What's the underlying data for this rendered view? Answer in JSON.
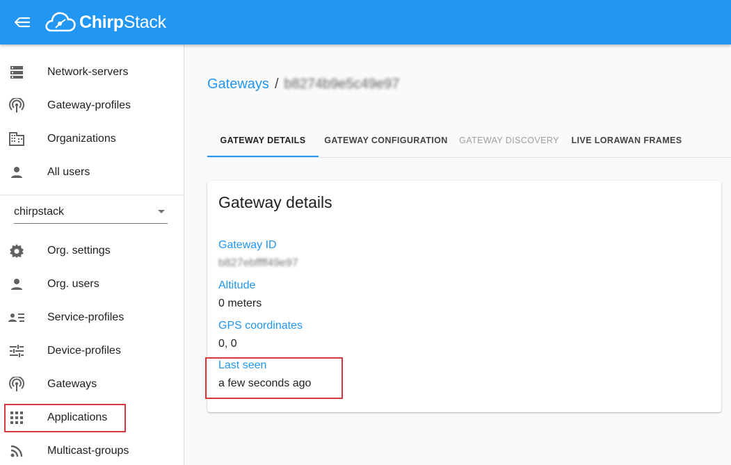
{
  "app": {
    "logo_text_bold": "Chirp",
    "logo_text_rest": "Stack"
  },
  "sidebar": {
    "admin_items": [
      {
        "label": "Network-servers",
        "icon": "server-icon"
      },
      {
        "label": "Gateway-profiles",
        "icon": "antenna-icon"
      },
      {
        "label": "Organizations",
        "icon": "domain-icon"
      },
      {
        "label": "All users",
        "icon": "person-icon"
      }
    ],
    "org_select": {
      "value": "chirpstack"
    },
    "org_items": [
      {
        "label": "Org. settings",
        "icon": "gear-icon"
      },
      {
        "label": "Org. users",
        "icon": "person-icon"
      },
      {
        "label": "Service-profiles",
        "icon": "account-details-icon"
      },
      {
        "label": "Device-profiles",
        "icon": "tune-icon"
      },
      {
        "label": "Gateways",
        "icon": "antenna-icon"
      },
      {
        "label": "Applications",
        "icon": "apps-grid-icon"
      },
      {
        "label": "Multicast-groups",
        "icon": "rss-icon"
      }
    ]
  },
  "breadcrumb": {
    "link": "Gateways",
    "separator": "/",
    "current": "b8274b9e5c49e97"
  },
  "tabs": [
    {
      "label": "GATEWAY DETAILS",
      "state": "active"
    },
    {
      "label": "GATEWAY CONFIGURATION",
      "state": "normal"
    },
    {
      "label": "GATEWAY DISCOVERY",
      "state": "disabled"
    },
    {
      "label": "LIVE LORAWAN FRAMES",
      "state": "normal"
    }
  ],
  "card": {
    "title": "Gateway details",
    "fields": [
      {
        "label": "Gateway ID",
        "value": "b827ebffff49e97"
      },
      {
        "label": "Altitude",
        "value": "0 meters"
      },
      {
        "label": "GPS coordinates",
        "value": "0, 0"
      },
      {
        "label": "Last seen",
        "value": "a few seconds ago"
      }
    ]
  },
  "colors": {
    "primary": "#2196f3",
    "highlight_box": "#d9363e"
  }
}
